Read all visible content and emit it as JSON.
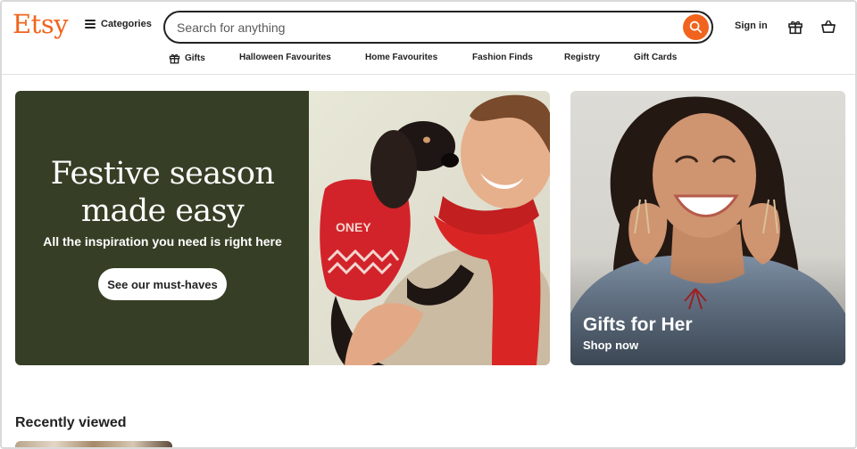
{
  "header": {
    "logo": "Etsy",
    "categories_label": "Categories",
    "search": {
      "placeholder": "Search for anything"
    },
    "signin_label": "Sign in"
  },
  "nav": {
    "items": [
      {
        "label": "Gifts",
        "icon": "gift-icon"
      },
      {
        "label": "Halloween Favourites"
      },
      {
        "label": "Home Favourites"
      },
      {
        "label": "Fashion Finds"
      },
      {
        "label": "Registry"
      },
      {
        "label": "Gift Cards"
      }
    ]
  },
  "hero": {
    "title_line1": "Festive season",
    "title_line2": "made easy",
    "subtitle": "All the inspiration you need is right here",
    "cta": "See our must-haves",
    "sweater_text": "ONEY"
  },
  "side_card": {
    "title": "Gifts for Her",
    "link": "Shop now"
  },
  "recently_viewed": {
    "title": "Recently viewed"
  },
  "colors": {
    "brand": "#f1641e",
    "hero_panel": "#363f25",
    "text": "#222222"
  }
}
